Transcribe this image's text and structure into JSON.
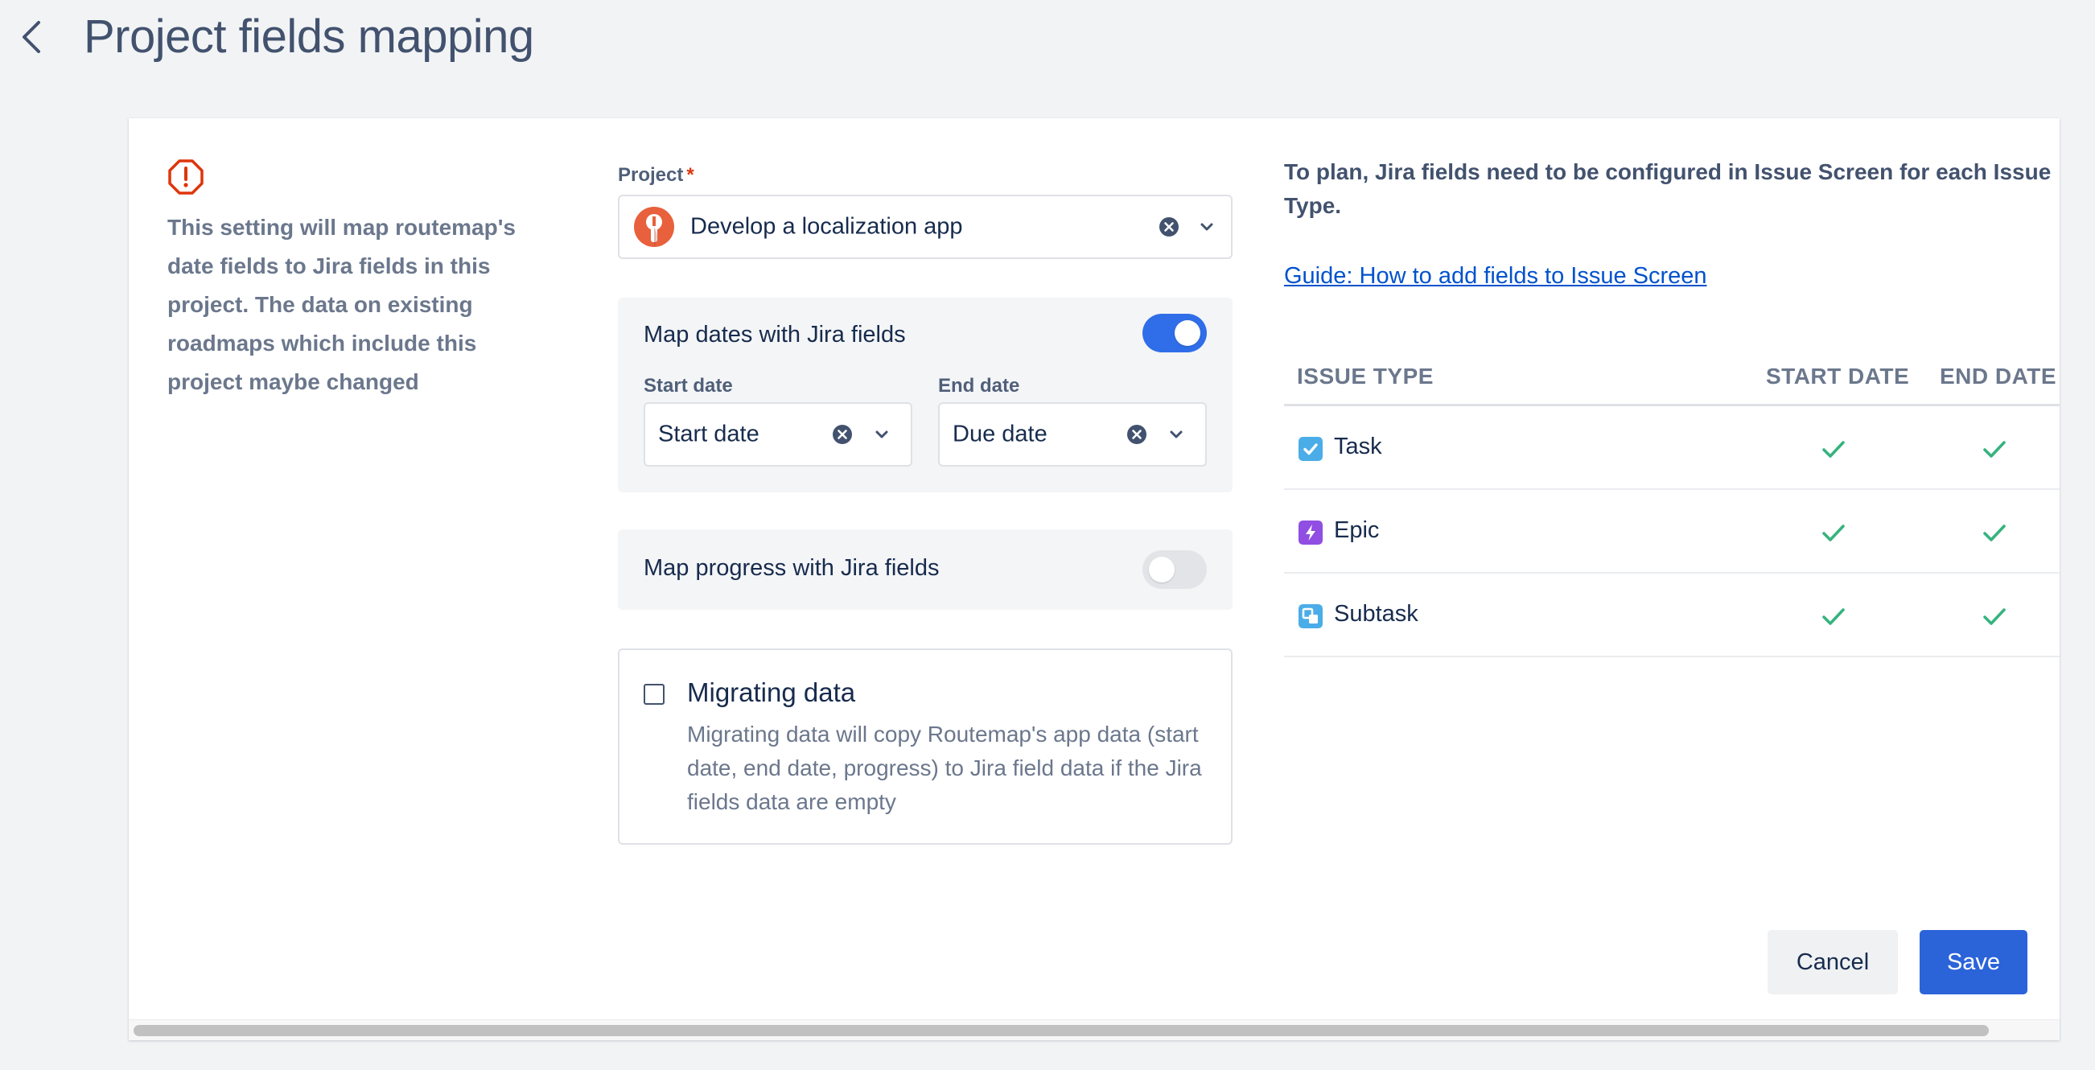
{
  "header": {
    "title": "Project fields mapping"
  },
  "info": {
    "text": "This setting will map routemap's date fields to Jira fields in this project. The data on existing roadmaps which include this project maybe changed"
  },
  "project_field": {
    "label": "Project",
    "required_mark": "*",
    "value": "Develop a localization app"
  },
  "map_dates": {
    "label": "Map dates with Jira fields",
    "enabled": true,
    "start_label": "Start date",
    "start_value": "Start date",
    "end_label": "End date",
    "end_value": "Due date"
  },
  "map_progress": {
    "label": "Map progress with Jira fields",
    "enabled": false
  },
  "migrate": {
    "checked": false,
    "title": "Migrating data",
    "description": "Migrating data will copy Routemap's app data (start date, end date, progress) to Jira field data if the Jira fields data are empty"
  },
  "right": {
    "note": "To plan, Jira fields need to be configured in Issue Screen for each Issue Type.",
    "guide_link": "Guide: How to add fields to Issue Screen"
  },
  "table": {
    "headers": [
      "ISSUE TYPE",
      "START DATE",
      "END DATE"
    ],
    "rows": [
      {
        "type": "Task",
        "icon": "task-icon",
        "color": "#4bade8",
        "start": true,
        "end": true
      },
      {
        "type": "Epic",
        "icon": "epic-icon",
        "color": "#904ee2",
        "start": true,
        "end": true
      },
      {
        "type": "Subtask",
        "icon": "subtask-icon",
        "color": "#4bade8",
        "start": true,
        "end": true
      }
    ]
  },
  "buttons": {
    "cancel": "Cancel",
    "save": "Save"
  },
  "colors": {
    "primary": "#2b63d9",
    "toggle_on": "#2f6ee8",
    "check": "#36b37e",
    "warning": "#de350b",
    "link": "#0052cc"
  }
}
